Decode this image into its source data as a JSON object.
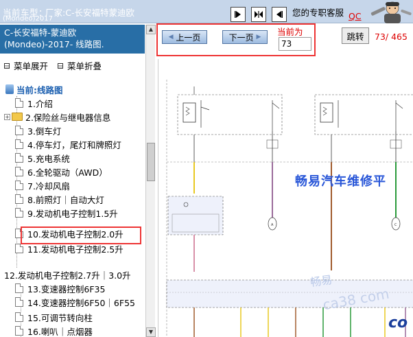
{
  "window": {
    "current_car_label": "当前车型：",
    "current_car_value": "厂家:C-长安福特蒙迪欧",
    "current_car_value_line2": "(Mondeo)2017",
    "service_text": "您的专职客服",
    "qc_link": "QC"
  },
  "nav_icons": {
    "first": "first-page-icon",
    "expand": "expand-icon",
    "last": "last-page-icon"
  },
  "left_panel": {
    "header_line1": "C-长安福特-蒙迪欧",
    "header_line2": "(Mondeo)-2017- 线路图.",
    "expand_all": "菜单展开",
    "collapse_all": "菜单折叠"
  },
  "tree": {
    "root": "当前:线路图",
    "items": [
      "1.介绍",
      "2.保险丝与继电器信息",
      "3.倒车灯",
      "4.停车灯，尾灯和牌照灯",
      "5.充电系统",
      "6.全轮驱动（AWD）",
      "7.冷却风扇",
      "8.前照灯｜自动大灯",
      "9.发动机电子控制1.5升",
      "10.发动机电子控制2.0升",
      "11.发动机电子控制2.5升",
      "12.发动机电子控制2.7升｜3.0升",
      "13.变速器控制6F35",
      "14.变速器控制6F50｜6F55",
      "15.可调节转向柱",
      "16.喇叭｜点烟器"
    ]
  },
  "pager": {
    "prev_label": "上一页",
    "next_label": "下一页",
    "current_label": "当前为",
    "current_page": "73",
    "jump_label": "跳转",
    "page_count": "73/ 465"
  },
  "diagram": {
    "watermark": "畅易汽车维修平",
    "watermark_sub_1": "畅易",
    "watermark_sub_2": "ca38 com",
    "logo": "co"
  }
}
